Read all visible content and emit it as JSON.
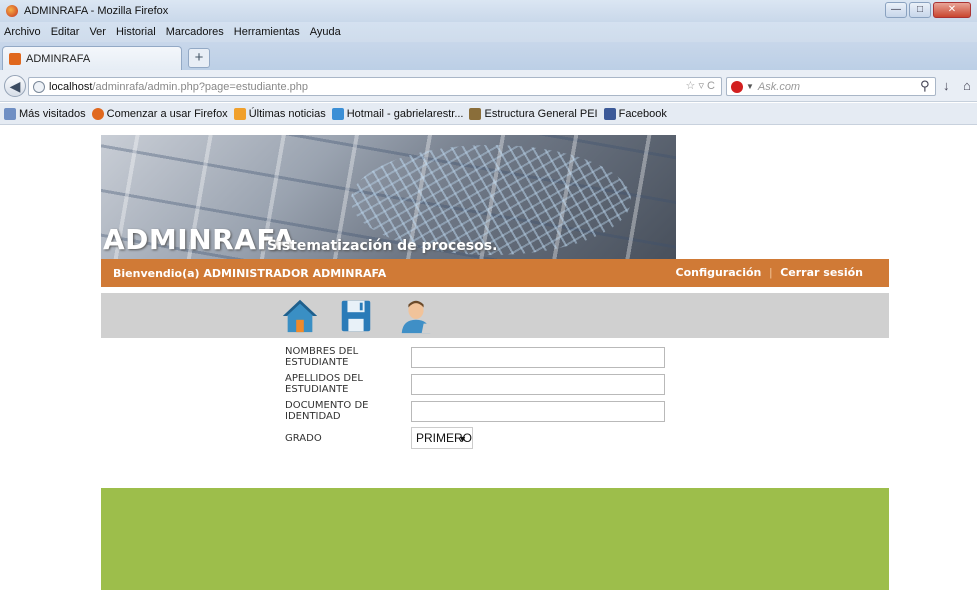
{
  "browser": {
    "window_title": "ADMINRAFA - Mozilla Firefox",
    "menu": [
      "Archivo",
      "Editar",
      "Ver",
      "Historial",
      "Marcadores",
      "Herramientas",
      "Ayuda"
    ],
    "tab_title": "ADMINRAFA",
    "new_tab": "+",
    "url_host": "localhost",
    "url_path": "/adminrafa/admin.php?page=estudiante.php",
    "search_placeholder": "Ask.com",
    "bookmarks": [
      {
        "label": "Más visitados",
        "icon": "page-icon",
        "color": "#6f8fc4"
      },
      {
        "label": "Comenzar a usar Firefox",
        "icon": "firefox-icon",
        "color": "#e0681e"
      },
      {
        "label": "Últimas noticias",
        "icon": "rss-icon",
        "color": "#f0a02c"
      },
      {
        "label": "Hotmail - gabrielarestr...",
        "icon": "msn-icon",
        "color": "#3b8fd6"
      },
      {
        "label": "Estructura General PEI",
        "icon": "image-icon",
        "color": "#8a6e3a"
      },
      {
        "label": "Facebook",
        "icon": "facebook-icon",
        "color": "#3b5998"
      }
    ]
  },
  "site": {
    "brand": "ADMINRAFA",
    "tagline": "Sistematización de procesos.",
    "welcome": "Bienvendio(a)  ADMINISTRADOR ADMINRAFA",
    "links": {
      "config": "Configuración",
      "sep": "|",
      "logout": "Cerrar sesión"
    },
    "colors": {
      "orange": "#d07a36",
      "green": "#9dbe4b",
      "gray": "#d0d0d0"
    }
  },
  "icons": [
    "home-icon",
    "save-icon",
    "user-icon"
  ],
  "form": {
    "nombres_label": "NOMBRES DEL ESTUDIANTE",
    "apellidos_label": "APELLIDOS DEL ESTUDIANTE",
    "documento_label": "DOCUMENTO DE IDENTIDAD",
    "grado_label": "GRADO",
    "grado_value": "PRIMERO"
  }
}
